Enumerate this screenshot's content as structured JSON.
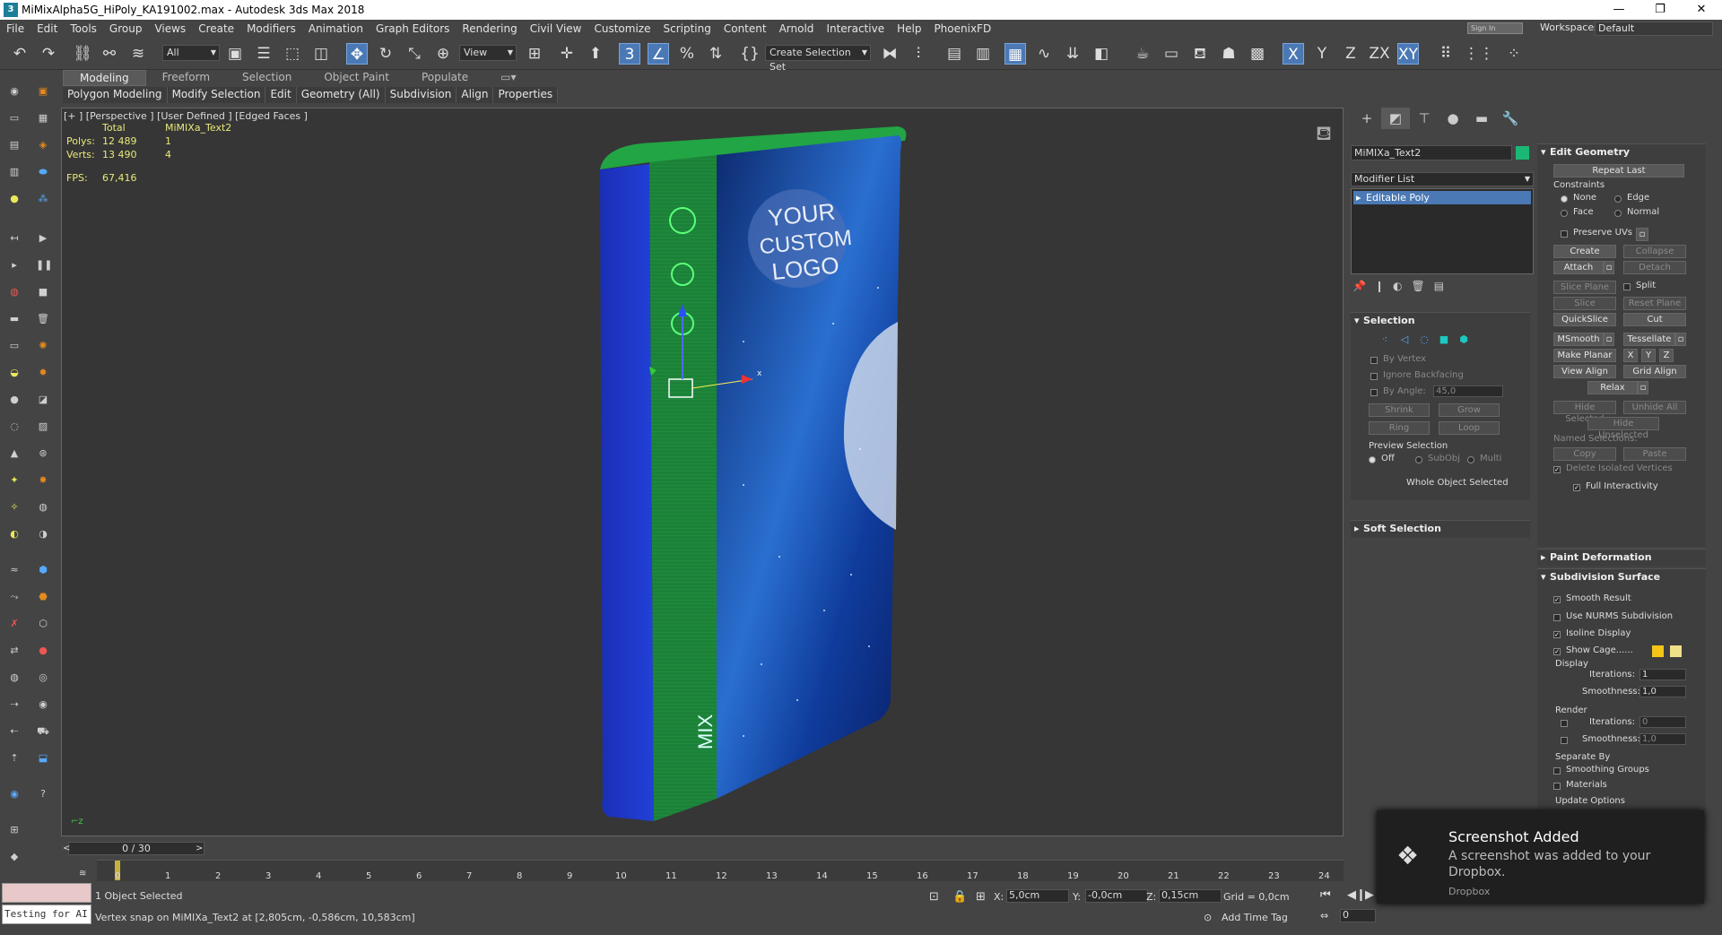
{
  "titlebar": {
    "title": "MiMixAlpha5G_HiPoly_KA191002.max - Autodesk 3ds Max 2018",
    "app_icon": "3"
  },
  "menu": [
    "File",
    "Edit",
    "Tools",
    "Group",
    "Views",
    "Create",
    "Modifiers",
    "Animation",
    "Graph Editors",
    "Rendering",
    "Civil View",
    "Customize",
    "Scripting",
    "Content",
    "Arnold",
    "Interactive",
    "Help",
    "PhoenixFD"
  ],
  "signin": "Sign In",
  "workspaces": {
    "label": "Workspaces:",
    "value": "Default"
  },
  "toolbar": {
    "filter": "All",
    "refcoord": "View",
    "selset": "Create Selection Set",
    "x": "X",
    "y": "Y",
    "z": "Z",
    "zx": "ZX",
    "xy": "XY"
  },
  "ribbon": {
    "tabs": [
      "Modeling",
      "Freeform",
      "Selection",
      "Object Paint",
      "Populate"
    ],
    "sub": [
      "Polygon Modeling",
      "Modify Selection",
      "Edit",
      "Geometry (All)",
      "Subdivision",
      "Align",
      "Properties"
    ]
  },
  "viewport": {
    "label": "[+ ] [Perspective ] [User Defined ] [Edged Faces ]",
    "stats_total": "Total",
    "stats_obj": "MiMIXa_Text2",
    "polys_label": "Polys:",
    "polys_total": "12 489",
    "polys_obj": "1",
    "verts_label": "Verts:",
    "verts_total": "13 490",
    "verts_obj": "4",
    "fps_label": "FPS:",
    "fps": "67,416",
    "logo_l1": "YOUR",
    "logo_l2": "CUSTOM",
    "logo_l3": "LOGO",
    "mix": "MIX"
  },
  "command": {
    "object_name": "MiMIXa_Text2",
    "object_color": "#1bb875",
    "modifier_list": "Modifier List",
    "stack_item": "Editable Poly",
    "edit_geometry": {
      "title": "Edit Geometry",
      "repeat_last": "Repeat Last",
      "constraints": "Constraints",
      "none": "None",
      "edge": "Edge",
      "face": "Face",
      "normal": "Normal",
      "preserve_uvs": "Preserve UVs",
      "create": "Create",
      "collapse": "Collapse",
      "attach": "Attach",
      "detach": "Detach",
      "slice_plane": "Slice Plane",
      "split": "Split",
      "slice": "Slice",
      "reset_plane": "Reset Plane",
      "quickslice": "QuickSlice",
      "cut": "Cut",
      "msmooth": "MSmooth",
      "tessellate": "Tessellate",
      "make_planar": "Make Planar",
      "px": "X",
      "py": "Y",
      "pz": "Z",
      "view_align": "View Align",
      "grid_align": "Grid Align",
      "relax": "Relax",
      "hide_selected": "Hide Selected",
      "unhide_all": "Unhide All",
      "hide_unselected": "Hide Unselected",
      "named_selections": "Named Selections:",
      "copy": "Copy",
      "paste": "Paste",
      "delete_isolated": "Delete Isolated Vertices",
      "full_interactivity": "Full Interactivity"
    },
    "selection": {
      "title": "Selection",
      "by_vertex": "By Vertex",
      "ignore_backfacing": "Ignore Backfacing",
      "by_angle": "By Angle:",
      "angle": "45,0",
      "shrink": "Shrink",
      "grow": "Grow",
      "ring": "Ring",
      "loop": "Loop",
      "preview": "Preview Selection",
      "off": "Off",
      "subobj": "SubObj",
      "multi": "Multi",
      "whole": "Whole Object Selected"
    },
    "soft_selection": "Soft Selection",
    "paint_deformation": "Paint Deformation",
    "subdivision": {
      "title": "Subdivision Surface",
      "smooth_result": "Smooth Result",
      "use_nurms": "Use NURMS Subdivision",
      "isoline": "Isoline Display",
      "show_cage": "Show Cage......",
      "cage_color1": "#f5c518",
      "cage_color2": "#f0e08a",
      "display": "Display",
      "iterations": "Iterations:",
      "disp_iter": "1",
      "smoothness": "Smoothness:",
      "disp_smooth": "1,0",
      "render": "Render",
      "rend_iter": "0",
      "rend_smooth": "1,0",
      "separate_by": "Separate By",
      "smoothing_groups": "Smoothing Groups",
      "materials": "Materials",
      "update_options": "Update Options"
    }
  },
  "timeline": {
    "slider": "0 / 30",
    "ticks": [
      "0",
      "1",
      "2",
      "3",
      "4",
      "5",
      "6",
      "7",
      "8",
      "9",
      "10",
      "11",
      "12",
      "13",
      "14",
      "15",
      "16",
      "17",
      "18",
      "19",
      "20",
      "21",
      "22",
      "23",
      "24"
    ]
  },
  "status": {
    "selected": "1 Object Selected",
    "prompt": "Vertex snap on MiMIXa_Text2 at [2,805cm, -0,586cm, 10,583cm]",
    "maxscript": "Testing for AI",
    "x_label": "X:",
    "x": "5,0cm",
    "y_label": "Y:",
    "y": "-0,0cm",
    "z_label": "Z:",
    "z": "0,15cm",
    "grid": "Grid = 0,0cm",
    "add_time_tag": "Add Time Tag",
    "frame": "0"
  },
  "toast": {
    "title": "Screenshot Added",
    "body": "A screenshot was added to your Dropbox.",
    "source": "Dropbox"
  }
}
